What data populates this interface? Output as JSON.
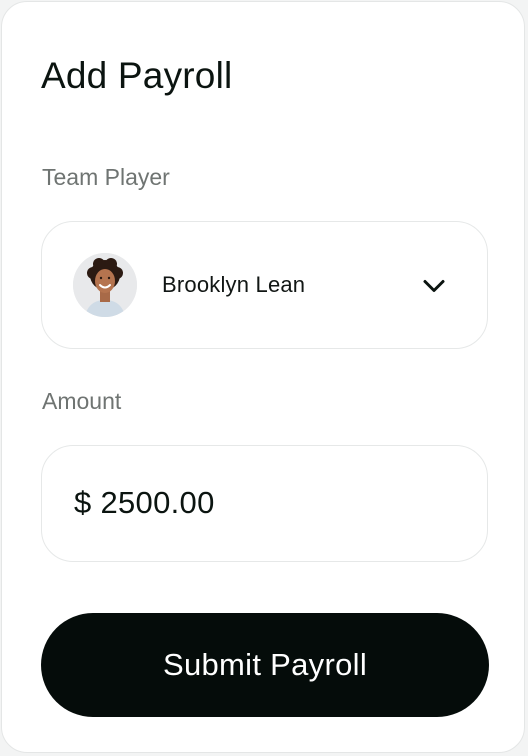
{
  "form": {
    "title": "Add Payroll",
    "team_player": {
      "label": "Team Player",
      "selected_name": "Brooklyn Lean",
      "avatar_icon": "person-avatar",
      "dropdown_icon": "chevron-down-icon"
    },
    "amount": {
      "label": "Amount",
      "value": "$ 2500.00"
    },
    "submit_label": "Submit Payroll"
  },
  "colors": {
    "primary_button": "#050c0a",
    "text_dark": "#0b1410",
    "text_muted": "#6f7472",
    "border": "#e6e8e8"
  }
}
